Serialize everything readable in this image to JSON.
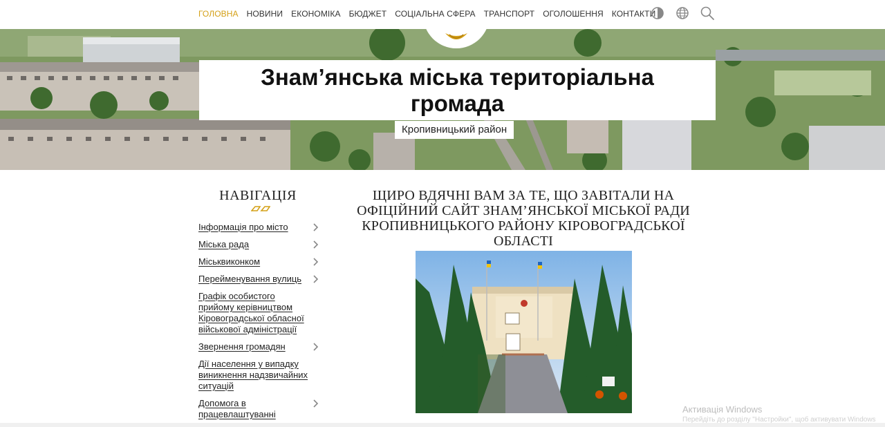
{
  "nav": {
    "items": [
      {
        "label": "ГОЛОВНА",
        "active": true
      },
      {
        "label": "НОВИНИ",
        "active": false
      },
      {
        "label": "ЕКОНОМІКА",
        "active": false
      },
      {
        "label": "БЮДЖЕТ",
        "active": false
      },
      {
        "label": "СОЦІАЛЬНА СФЕРА",
        "active": false
      },
      {
        "label": "ТРАНСПОРТ",
        "active": false
      },
      {
        "label": "ОГОЛОШЕННЯ",
        "active": false
      },
      {
        "label": "КОНТАКТИ",
        "active": false
      }
    ],
    "tools": [
      "contrast-icon",
      "globe-icon",
      "search-icon"
    ],
    "active_color": "#d4a017"
  },
  "hero": {
    "title": "Знам’янська міська територіальна громада",
    "district": "Кропивницький район"
  },
  "sidebar": {
    "heading": "НАВІГАЦІЯ",
    "items": [
      {
        "label": "Інформація про місто",
        "has_submenu": true
      },
      {
        "label": "Міська рада",
        "has_submenu": true
      },
      {
        "label": "Міськвиконком",
        "has_submenu": true
      },
      {
        "label": "Перейменування вулиць",
        "has_submenu": true
      },
      {
        "label": "Графік особистого прийому керівництвом Кіровоградської обласної військової адміністрації",
        "has_submenu": false
      },
      {
        "label": "Звернення громадян",
        "has_submenu": true
      },
      {
        "label": "Дії населення у випадку виникнення надзвичайних ситуацій",
        "has_submenu": false
      },
      {
        "label": "Допомога в працевлаштуванні",
        "has_submenu": true
      }
    ]
  },
  "main": {
    "welcome": "ЩИРО ВДЯЧНІ ВАМ ЗА ТЕ, ЩО ЗАВІТАЛИ НА ОФІЦІЙНИЙ САЙТ ЗНАМ’ЯНСЬКОЇ МІСЬКОЇ РАДИ КРОПИВНИЦЬКОГО РАЙОНУ КІРОВОГРАДСЬКОЇ ОБЛАСТІ"
  },
  "watermark": {
    "line1": "Активація Windows",
    "line2": "Перейдіть до розділу \"Настройки\", щоб активувати Windows"
  },
  "colors": {
    "accent": "#d4a017",
    "ornament": "#d4a017"
  }
}
